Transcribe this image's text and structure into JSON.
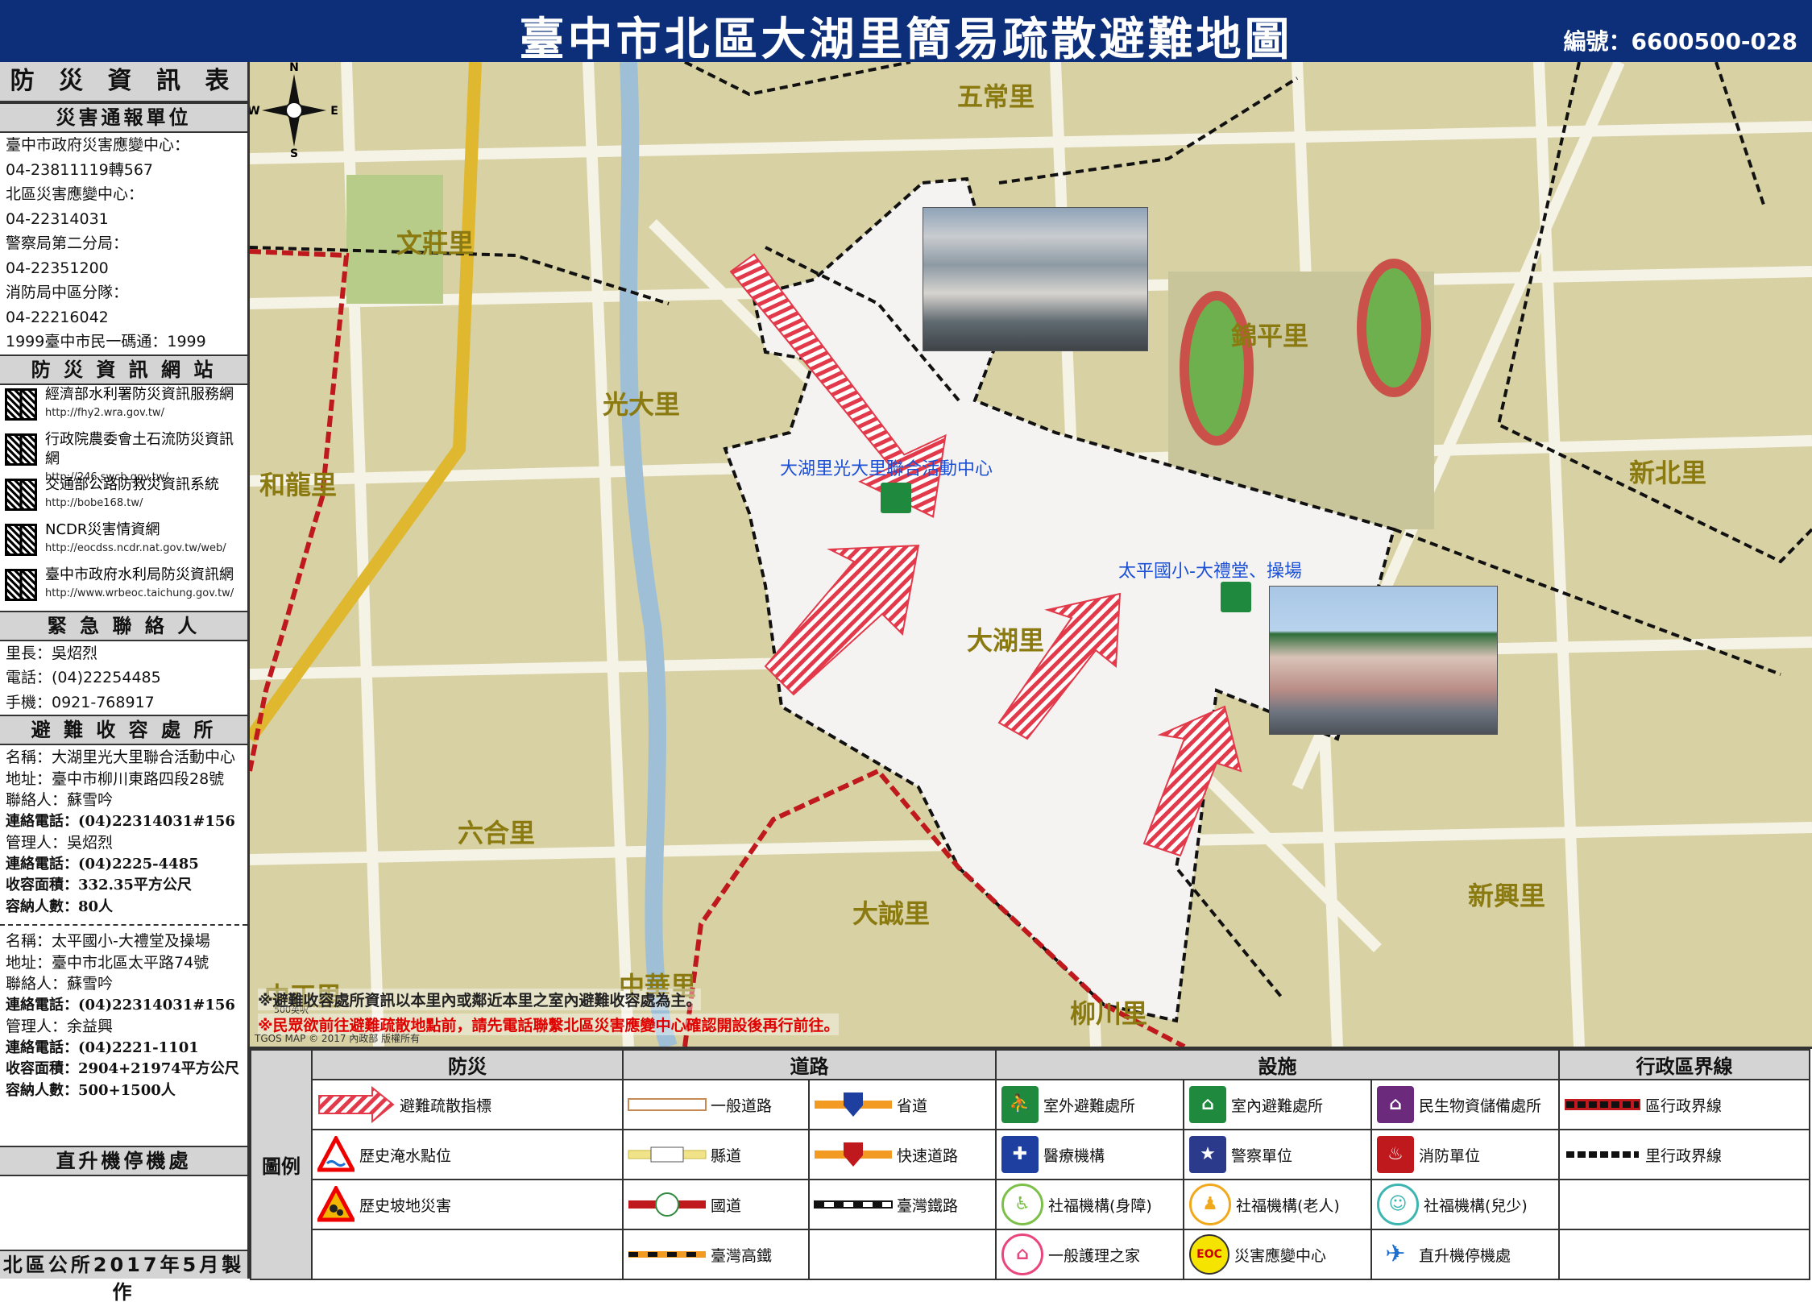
{
  "title": "臺中市北區大湖里簡易疏散避難地圖",
  "map_code": "編號：6600500-028",
  "sidebar": {
    "info_table_title": "防 災 資 訊 表",
    "report_unit_title": "災害通報單位",
    "report_lines": [
      "臺中市政府災害應變中心：",
      "04-23811119轉567",
      "北區災害應變中心：",
      "04-22314031",
      "警察局第二分局：",
      "04-22351200",
      "消防局中區分隊：",
      "04-22216042",
      "1999臺中市民一碼通：1999"
    ],
    "websites_title": "防 災 資 訊 網 站",
    "websites": [
      {
        "name": "經濟部水利署防災資訊服務網",
        "url": "http://fhy2.wra.gov.tw/"
      },
      {
        "name": "行政院農委會土石流防災資訊網",
        "url": "http://246.swcb.gov.tw/"
      },
      {
        "name": "交通部公路防救災資訊系統",
        "url": "http://bobe168.tw/"
      },
      {
        "name": "NCDR災害情資網",
        "url": "http://eocdss.ncdr.nat.gov.tw/web/"
      },
      {
        "name": "臺中市政府水利局防災資訊網",
        "url": "http://www.wrbeoc.taichung.gov.tw/"
      }
    ],
    "contact_title": "緊 急 聯 絡 人",
    "contact_lines": [
      "里長：吳炤烈",
      "電話：(04)22254485",
      "手機：0921-768917"
    ],
    "shelter_title": "避 難 收 容 處 所",
    "shelter1": [
      "名稱：大湖里光大里聯合活動中心",
      "地址：臺中市柳川東路四段28號",
      "聯絡人：蘇雪吟",
      "連絡電話：(04)22314031#156",
      "管理人：吳炤烈",
      "連絡電話：(04)2225-4485",
      "收容面積：332.35平方公尺",
      "容納人數：80人"
    ],
    "shelter2": [
      "名稱：太平國小-大禮堂及操場",
      "地址：臺中市北區太平路74號",
      "聯絡人：蘇雪吟",
      "連絡電話：(04)22314031#156",
      "管理人：余益興",
      "連絡電話：(04)2221-1101",
      "收容面積：2904+21974平方公尺",
      "容納人數：500+1500人"
    ],
    "heli_title": "直升機停機處",
    "footer": "北區公所2017年5月製作"
  },
  "map": {
    "districts": [
      "五常里",
      "文莊里",
      "光大里",
      "和龍里",
      "錦平里",
      "新北里",
      "大湖里",
      "六合里",
      "大誠里",
      "新興里",
      "柳川里",
      "中華里",
      "中正里"
    ],
    "site1_label": "大湖里光大里聯合活動中心",
    "site2_label": "太平國小-大禮堂、操場",
    "note1": "※避難收容處所資訊以本里內或鄰近本里之室內避難收容處為主。",
    "note2": "※民眾欲前往避難疏散地點前，請先電話聯繫北區災害應變中心確認開設後再行前往。",
    "copyright": "TGOS MAP © 2017 內政部 版權所有",
    "scale": "500英呎",
    "compass": {
      "n": "N",
      "s": "S",
      "e": "E",
      "w": "W"
    }
  },
  "legend": {
    "label": "圖例",
    "headers": [
      "防災",
      "道路",
      "設施",
      "行政區界線"
    ],
    "disaster": [
      "避難疏散指標",
      "歷史淹水點位",
      "歷史坡地災害"
    ],
    "roads": [
      "一般道路",
      "省道",
      "縣道",
      "快速道路",
      "國道",
      "臺灣鐵路",
      "臺灣高鐵"
    ],
    "facilities": [
      "室外避難處所",
      "室內避難處所",
      "民生物資儲備處所",
      "醫療機構",
      "警察單位",
      "消防單位",
      "社福機構(身障)",
      "社福機構(老人)",
      "社福機構(兒少)",
      "一般護理之家",
      "災害應變中心",
      "直升機停機處"
    ],
    "eoc_badge": "EOC",
    "boundaries": [
      "區行政界線",
      "里行政界線"
    ]
  }
}
